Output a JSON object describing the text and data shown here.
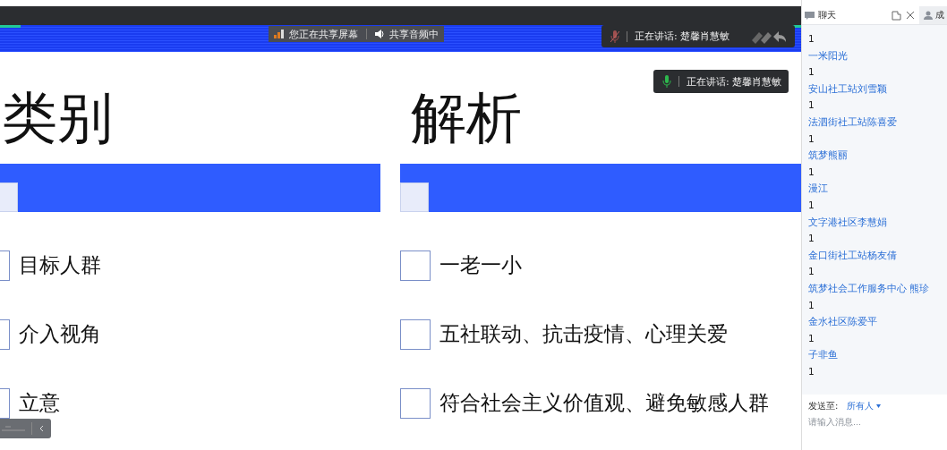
{
  "top_bar": {
    "share_status": "您正在共享屏幕",
    "audio_status": "共享音频中"
  },
  "speaker_panels": [
    {
      "label": "正在讲话: 楚馨肖慧敏",
      "mic_muted": true
    },
    {
      "label": "正在讲话:  楚馨肖慧敏",
      "mic_muted": false
    }
  ],
  "slide": {
    "columns": [
      {
        "heading": "类别",
        "items": [
          "目标人群",
          "介入视角",
          "立意"
        ]
      },
      {
        "heading": "解析",
        "items": [
          "一老一小",
          "五社联动、抗击疫情、心理关爱",
          "符合社会主义价值观、避免敏感人群"
        ]
      }
    ]
  },
  "chat": {
    "title": "聊天",
    "members_tab": "成",
    "messages": [
      {
        "kind": "text",
        "text": "1"
      },
      {
        "kind": "sender",
        "text": "一米阳光"
      },
      {
        "kind": "text",
        "text": "1"
      },
      {
        "kind": "sender",
        "text": "安山社工站刘雪颖"
      },
      {
        "kind": "text",
        "text": "1"
      },
      {
        "kind": "sender",
        "text": "法泗街社工站陈喜爱"
      },
      {
        "kind": "text",
        "text": "1"
      },
      {
        "kind": "sender",
        "text": "筑梦熊丽"
      },
      {
        "kind": "text",
        "text": "1"
      },
      {
        "kind": "sender",
        "text": "漫江"
      },
      {
        "kind": "text",
        "text": "1"
      },
      {
        "kind": "sender",
        "text": "文字港社区李慧娟"
      },
      {
        "kind": "text",
        "text": "1"
      },
      {
        "kind": "sender",
        "text": "金口街社工站杨友倩"
      },
      {
        "kind": "text",
        "text": "1"
      },
      {
        "kind": "sender",
        "text": "筑梦社会工作服务中心 熊珍"
      },
      {
        "kind": "text",
        "text": "1"
      },
      {
        "kind": "sender",
        "text": "金水社区陈爱平"
      },
      {
        "kind": "text",
        "text": "1"
      },
      {
        "kind": "sender",
        "text": "子非鱼"
      },
      {
        "kind": "text",
        "text": "1"
      }
    ],
    "send_to_label": "发送至:",
    "send_to_value": "所有人",
    "input_placeholder": "请输入消息..."
  }
}
